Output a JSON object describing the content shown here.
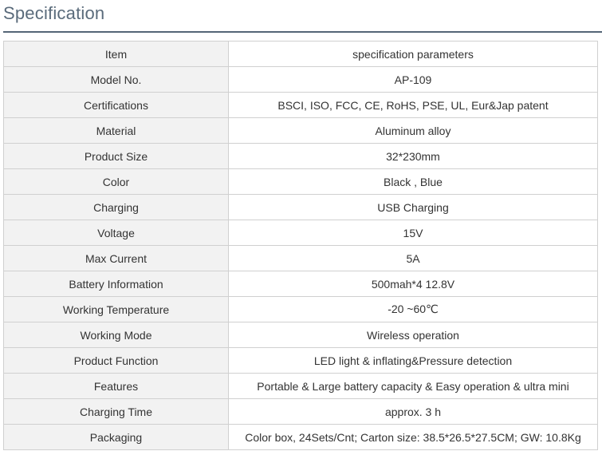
{
  "page": {
    "title": "Specification"
  },
  "table": {
    "header": {
      "item": "Item",
      "param": "specification parameters"
    },
    "rows": [
      {
        "item": "Model No.",
        "value": "AP-109"
      },
      {
        "item": "Certifications",
        "value": "BSCI, ISO, FCC, CE, RoHS, PSE, UL, Eur&Jap patent"
      },
      {
        "item": "Material",
        "value": "Aluminum alloy"
      },
      {
        "item": "Product Size",
        "value": "32*230mm"
      },
      {
        "item": "Color",
        "value": "Black , Blue"
      },
      {
        "item": "Charging",
        "value": "USB Charging"
      },
      {
        "item": "Voltage",
        "value": "15V"
      },
      {
        "item": "Max Current",
        "value": "5A"
      },
      {
        "item": "Battery Information",
        "value": "500mah*4 12.8V"
      },
      {
        "item": "Working Temperature",
        "value": "-20 ~60℃"
      },
      {
        "item": "Working Mode",
        "value": "Wireless operation"
      },
      {
        "item": "Product Function",
        "value": "LED light & inflating&Pressure detection"
      },
      {
        "item": "Features",
        "value": "Portable & Large battery capacity & Easy operation & ultra mini"
      },
      {
        "item": "Charging Time",
        "value": "approx. 3 h"
      },
      {
        "item": "Packaging",
        "value": "Color box, 24Sets/Cnt; Carton size: 38.5*26.5*27.5CM; GW: 10.8Kg"
      }
    ]
  }
}
